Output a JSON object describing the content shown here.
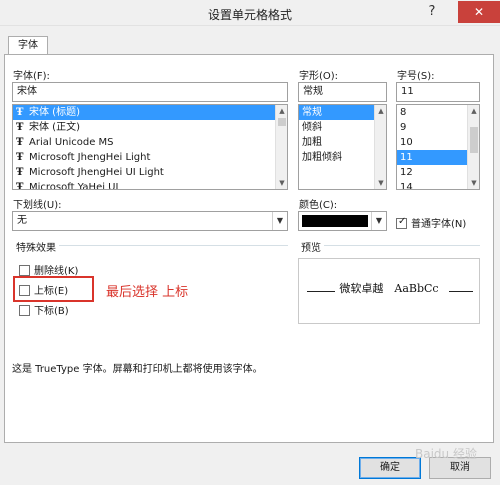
{
  "window": {
    "title": "设置单元格格式",
    "help_label": "?",
    "close_label": "✕"
  },
  "tabs": [
    {
      "label": "字体",
      "active": true
    }
  ],
  "font": {
    "label": "字体(F):",
    "value": "宋体",
    "items": [
      {
        "label": "宋体 (标题)",
        "selected": true
      },
      {
        "label": "宋体 (正文)",
        "selected": false
      },
      {
        "label": "Arial Unicode MS",
        "selected": false
      },
      {
        "label": "Microsoft JhengHei Light",
        "selected": false
      },
      {
        "label": "Microsoft JhengHei UI Light",
        "selected": false
      },
      {
        "label": "Microsoft YaHei UI",
        "selected": false
      }
    ],
    "type_icon": "truetype-icon"
  },
  "style": {
    "label": "字形(O):",
    "value": "常规",
    "items": [
      {
        "label": "常规",
        "selected": true
      },
      {
        "label": "倾斜",
        "selected": false
      },
      {
        "label": "加粗",
        "selected": false
      },
      {
        "label": "加粗倾斜",
        "selected": false
      }
    ]
  },
  "size": {
    "label": "字号(S):",
    "value": "11",
    "items": [
      {
        "label": "8",
        "selected": false
      },
      {
        "label": "9",
        "selected": false
      },
      {
        "label": "10",
        "selected": false
      },
      {
        "label": "11",
        "selected": true
      },
      {
        "label": "12",
        "selected": false
      },
      {
        "label": "14",
        "selected": false
      }
    ]
  },
  "underline": {
    "label": "下划线(U):",
    "value": "无"
  },
  "color": {
    "label": "颜色(C):",
    "swatch": "#000000"
  },
  "normal_font": {
    "label": "普通字体(N)",
    "checked": true
  },
  "effects": {
    "title": "特殊效果",
    "strikethrough": {
      "label": "删除线(K)",
      "checked": false
    },
    "superscript": {
      "label": "上标(E)",
      "checked": false
    },
    "subscript": {
      "label": "下标(B)",
      "checked": false
    }
  },
  "annotation": {
    "text": "最后选择 上标",
    "color": "#d9342b"
  },
  "preview": {
    "title": "预览",
    "sample": "微软卓越　AaBbCc"
  },
  "info_text": "这是 TrueType 字体。屏幕和打印机上都将使用该字体。",
  "buttons": {
    "ok": "确定",
    "cancel": "取消"
  },
  "watermark": "Baidu 经验"
}
